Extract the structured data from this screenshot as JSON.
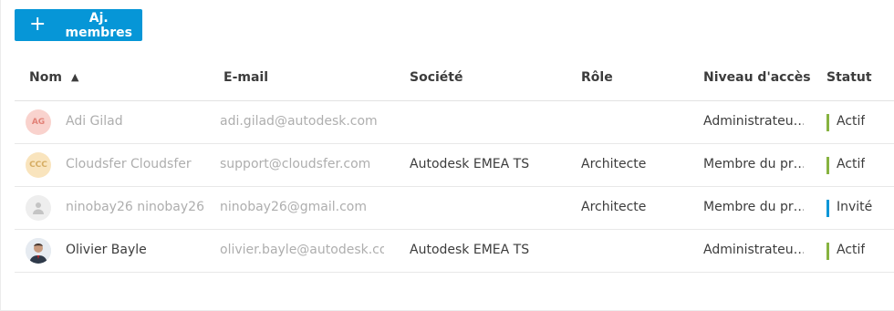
{
  "toolbar": {
    "add_members_label": "Aj. membres"
  },
  "columns": {
    "name": "Nom",
    "email": "E-mail",
    "company": "Société",
    "role": "Rôle",
    "access": "Niveau d'accès",
    "status": "Statut"
  },
  "rows": [
    {
      "initials": "AG",
      "name": "Adi Gilad",
      "email": "adi.gilad@autodesk.com",
      "company": "",
      "role": "",
      "access": "Administrateu…",
      "status": "Actif",
      "status_type": "active",
      "faded": true
    },
    {
      "initials": "CCC",
      "name": "Cloudsfer Cloudsfer",
      "email": "support@cloudsfer.com",
      "company": "Autodesk EMEA TS",
      "role": "Architecte",
      "access": "Membre du pr…",
      "status": "Actif",
      "status_type": "active",
      "faded": true
    },
    {
      "initials": "",
      "name": "ninobay26 ninobay26",
      "email": "ninobay26@gmail.com",
      "company": "",
      "role": "Architecte",
      "access": "Membre du pr…",
      "status": "Invité",
      "status_type": "invited",
      "faded": true
    },
    {
      "initials": "",
      "name": "Olivier Bayle",
      "email": "olivier.bayle@autodesk.com",
      "company": "Autodesk EMEA TS",
      "role": "",
      "access": "Administrateu…",
      "status": "Actif",
      "status_type": "active",
      "faded": false
    }
  ],
  "colors": {
    "accent": "#0696d7",
    "active": "#87b340",
    "invited": "#0696d7"
  }
}
